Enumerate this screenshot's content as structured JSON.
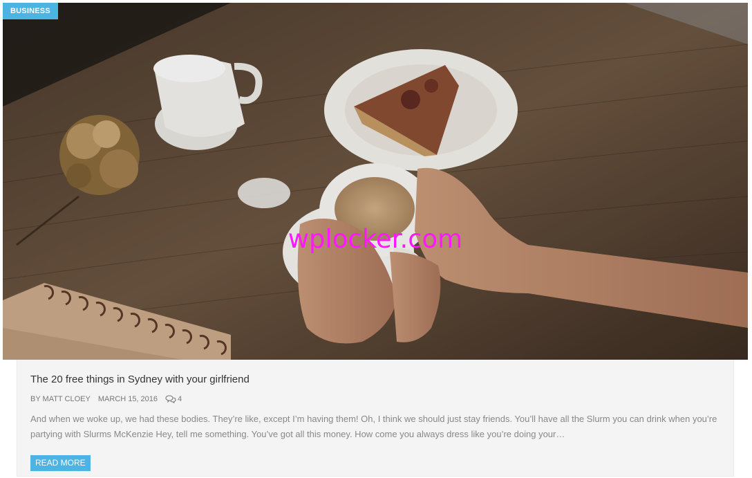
{
  "post": {
    "category": "BUSINESS",
    "watermark": "wplocker.com",
    "title": "The 20 free things in Sydney with your girlfriend",
    "meta": {
      "author": "BY MATT CLOEY",
      "date": "MARCH 15, 2016",
      "comments_icon": "comments-icon",
      "comments_count": "4"
    },
    "excerpt": "And when we woke up, we had these bodies. They’re like, except I’m having them! Oh, I think we should just stay friends. You’ll have all the Slurm you can drink when you’re partying with Slurms McKenzie Hey, tell me something. You’ve got all this money. How come you always dress like you’re doing your…",
    "read_more": "READ MORE"
  },
  "colors": {
    "accent": "#4cb4e3",
    "watermark": "#ff18ff",
    "card_bg": "#f4f4f4",
    "title": "#333333",
    "text_muted": "#888888"
  }
}
